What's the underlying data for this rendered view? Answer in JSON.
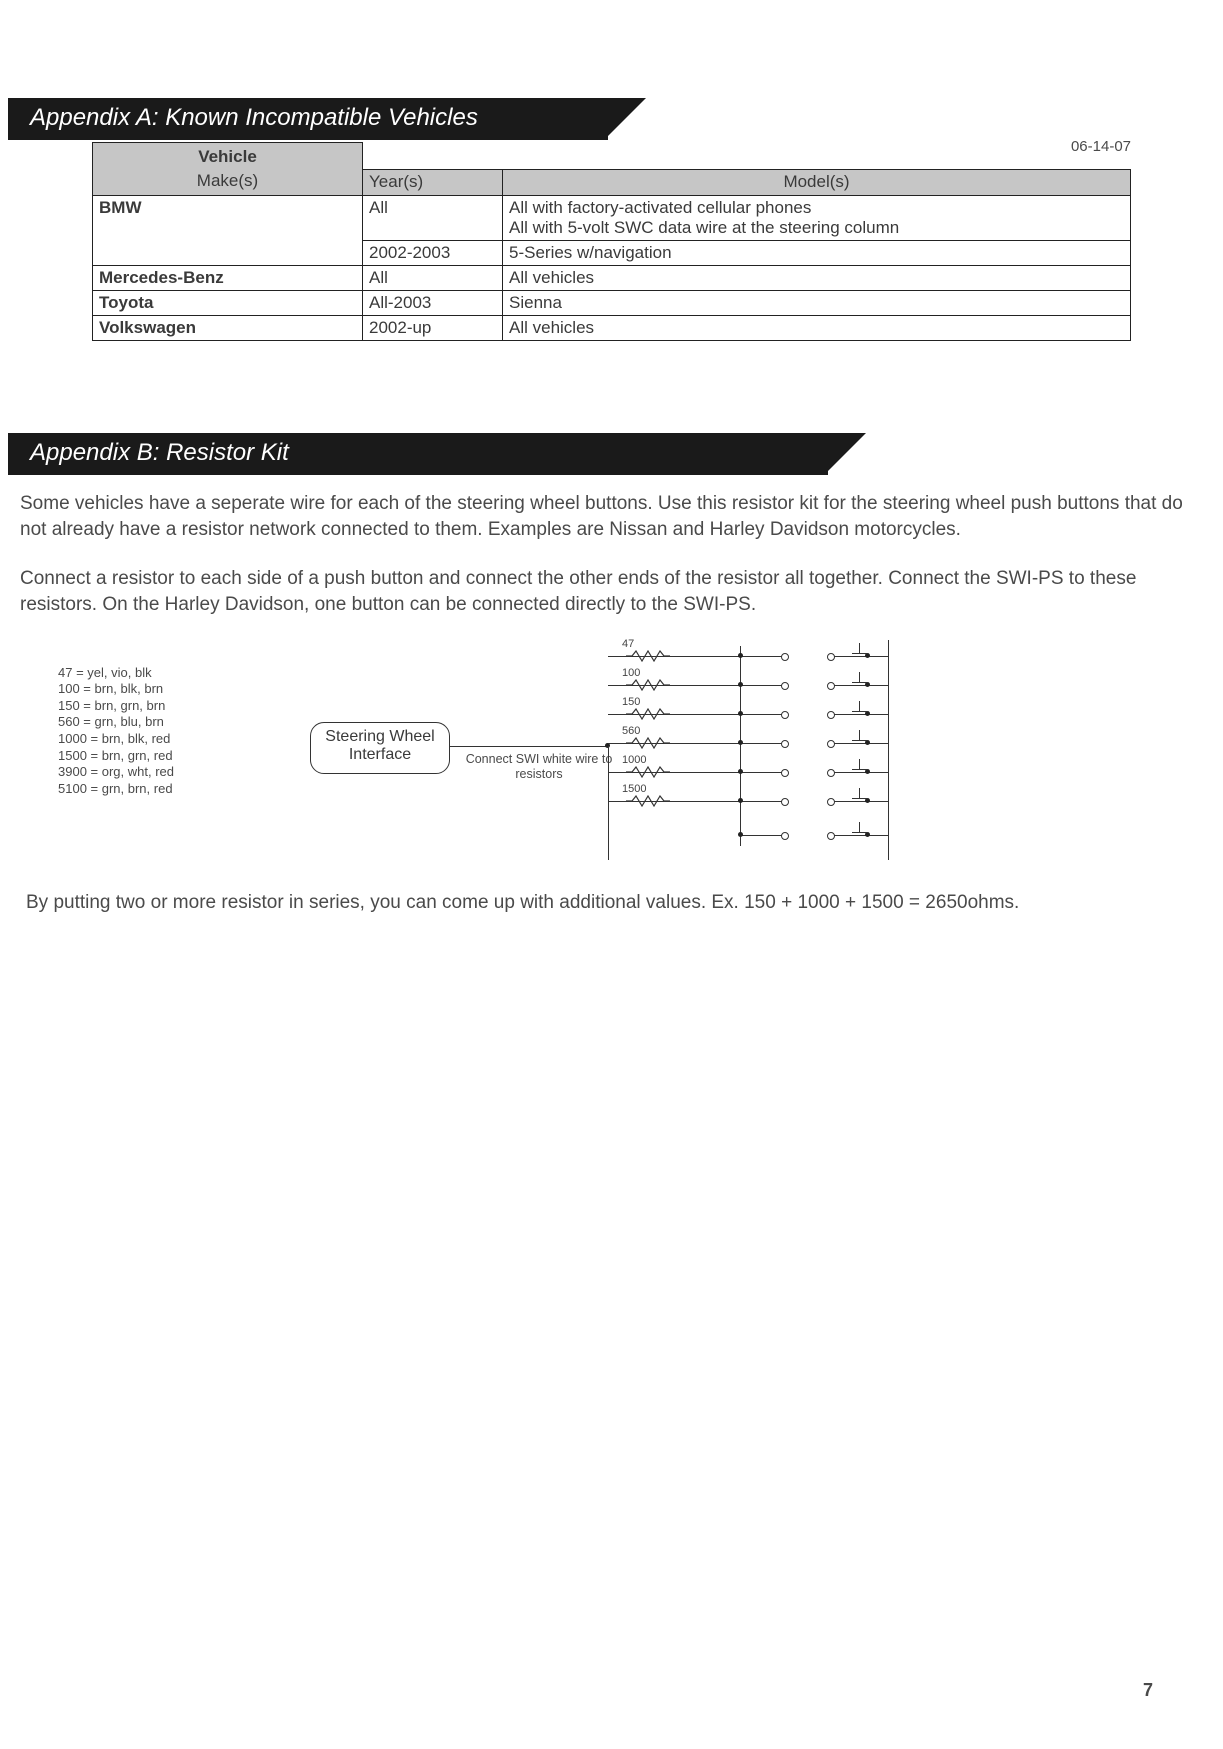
{
  "date": "06-14-07",
  "page_number": "7",
  "appendix_a": {
    "title": "Appendix A: Known Incompatible Vehicles",
    "headers": {
      "vehicle": "Vehicle",
      "makes": "Make(s)",
      "years": "Year(s)",
      "models": "Model(s)"
    },
    "rows": [
      {
        "make": "BMW",
        "year": "All",
        "model": "All with factory-activated cellular phones\nAll with 5-volt SWC data wire at the steering column"
      },
      {
        "make": "",
        "year": "2002-2003",
        "model": "5-Series w/navigation"
      },
      {
        "make": "Mercedes-Benz",
        "year": "All",
        "model": "All vehicles"
      },
      {
        "make": "Toyota",
        "year": "All-2003",
        "model": "Sienna"
      },
      {
        "make": "Volkswagen",
        "year": "2002-up",
        "model": "All vehicles"
      }
    ]
  },
  "appendix_b": {
    "title": "Appendix B: Resistor Kit",
    "para1": "Some vehicles have a seperate wire for each of the steering wheel buttons. Use this resistor kit for the steering wheel push buttons that do not already have a resistor network connected to them.  Examples are Nissan and Harley Davidson motorcycles.",
    "para2": "Connect a resistor to each side of a push button and connect the other ends of the resistor all together. Connect the SWI-PS to these resistors. On the Harley Davidson, one button can be connected directly to the SWI-PS.",
    "resistor_legend": [
      "47 = yel, vio, blk",
      "100 = brn, blk, brn",
      "150 = brn,  grn, brn",
      "560 = grn, blu, brn",
      "1000 = brn, blk, red",
      "1500 = brn, grn, red",
      "3900 = org, wht, red",
      "5100 = grn, brn, red"
    ],
    "swi_box": "Steering Wheel Interface",
    "connect_note": "Connect SWI white wire to resistors",
    "ladder_values": [
      "47",
      "100",
      "150",
      "560",
      "1000",
      "1500",
      ""
    ],
    "para3": "By putting two or more resistor in series, you can come up with additional values. Ex. 150 + 1000 + 1500 = 2650ohms."
  }
}
